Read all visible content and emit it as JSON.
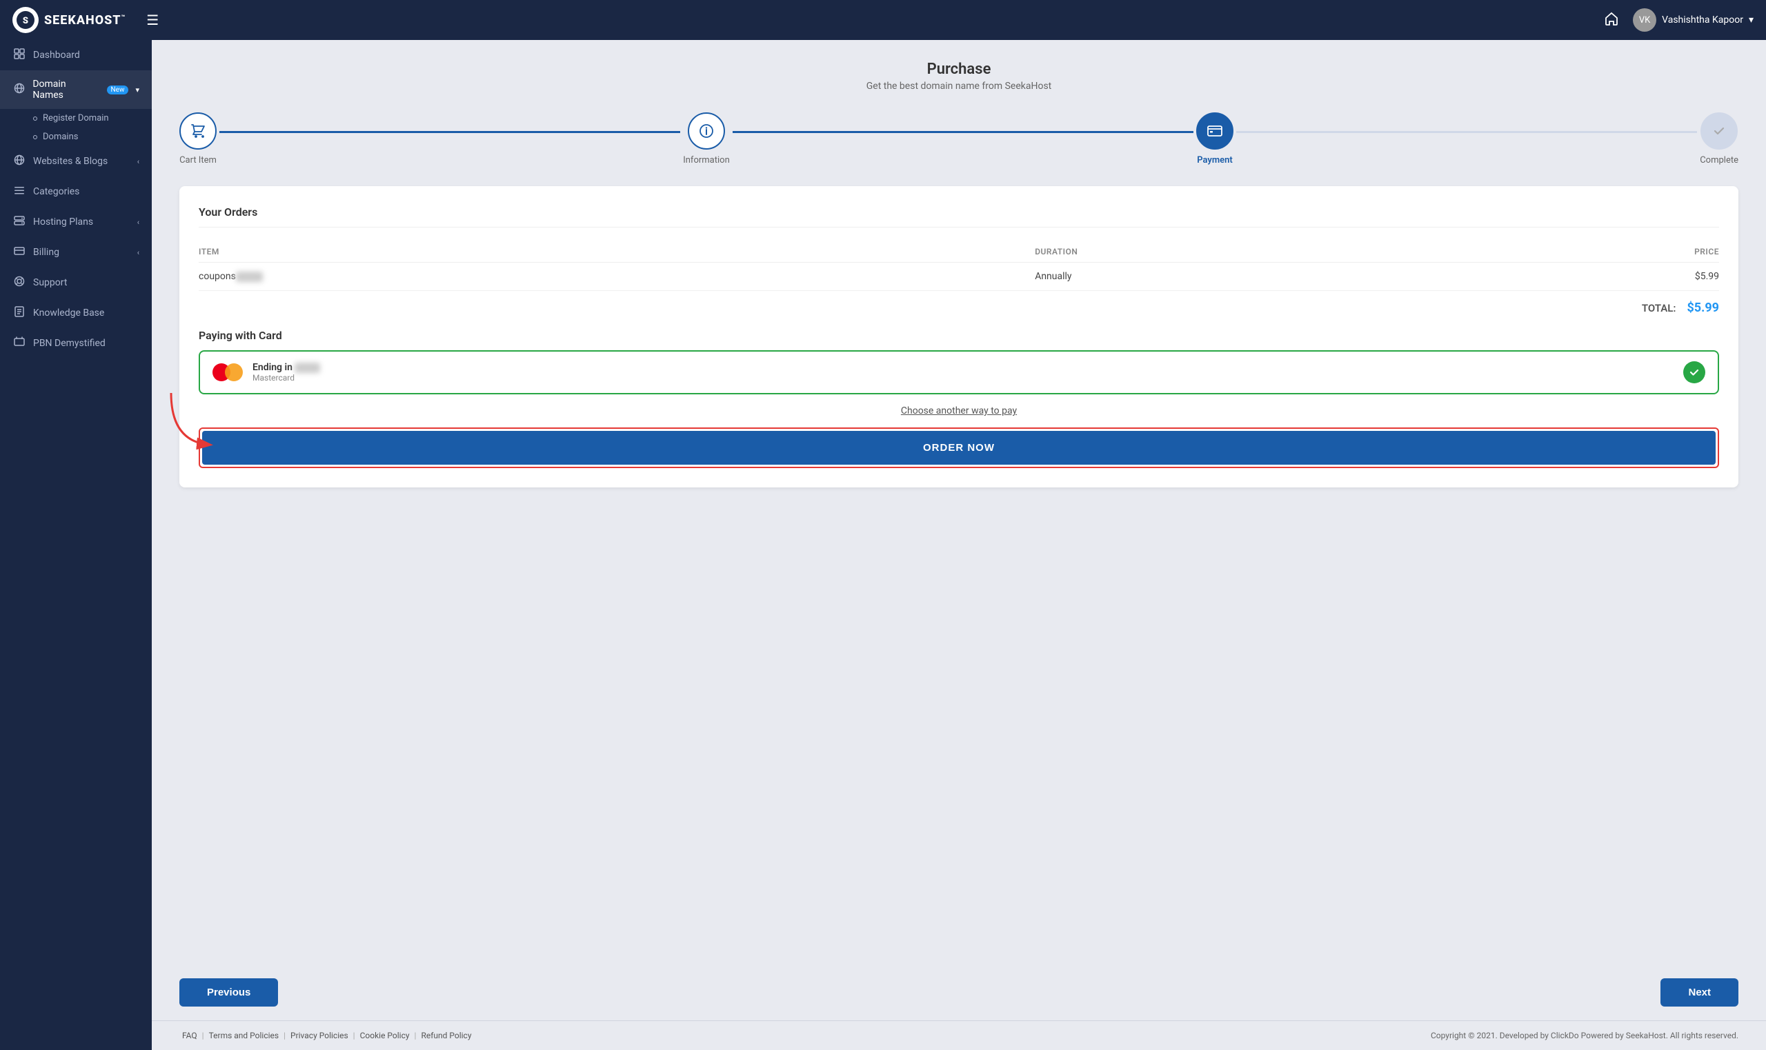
{
  "app": {
    "name": "SEEKAHOST",
    "name_tm": "™"
  },
  "topbar": {
    "menu_label": "☰",
    "home_label": "⌂",
    "user_name": "Vashishtha Kapoor",
    "user_chevron": "▾"
  },
  "sidebar": {
    "items": [
      {
        "id": "dashboard",
        "icon": "⌂",
        "label": "Dashboard"
      },
      {
        "id": "domain-names",
        "icon": "🌐",
        "label": "Domain Names",
        "badge": "New",
        "chevron": "▾",
        "active": true
      },
      {
        "id": "register-domain",
        "icon": "○",
        "label": "Register Domain",
        "sub": true
      },
      {
        "id": "domains",
        "icon": "○",
        "label": "Domains",
        "sub": true
      },
      {
        "id": "websites-blogs",
        "icon": "🌐",
        "label": "Websites & Blogs",
        "chevron": "‹"
      },
      {
        "id": "categories",
        "icon": "☰",
        "label": "Categories"
      },
      {
        "id": "hosting-plans",
        "icon": "📦",
        "label": "Hosting Plans",
        "chevron": "‹"
      },
      {
        "id": "billing",
        "icon": "💳",
        "label": "Billing",
        "chevron": "‹"
      },
      {
        "id": "support",
        "icon": "⚙",
        "label": "Support"
      },
      {
        "id": "knowledge-base",
        "icon": "📖",
        "label": "Knowledge Base"
      },
      {
        "id": "pbn-demystified",
        "icon": "🖥",
        "label": "PBN Demystified"
      }
    ]
  },
  "page": {
    "title": "Purchase",
    "subtitle": "Get the best domain name from SeekaHost"
  },
  "stepper": {
    "steps": [
      {
        "id": "cart",
        "icon": "🛒",
        "label": "Cart Item",
        "state": "done"
      },
      {
        "id": "info",
        "icon": "ℹ",
        "label": "Information",
        "state": "done"
      },
      {
        "id": "payment",
        "icon": "💳",
        "label": "Payment",
        "state": "active"
      },
      {
        "id": "complete",
        "icon": "✓",
        "label": "Complete",
        "state": "inactive"
      }
    ]
  },
  "orders": {
    "title": "Your Orders",
    "columns": {
      "item": "ITEM",
      "duration": "DURATION",
      "price": "PRICE"
    },
    "rows": [
      {
        "item": "coupons",
        "item_blurred": "••••••••",
        "duration": "Annually",
        "price": "$5.99"
      }
    ],
    "total_label": "TOTAL:",
    "total_value": "$5.99"
  },
  "payment": {
    "label": "Paying with Card",
    "card": {
      "ending_label": "Ending in",
      "ending_blurred": "••••",
      "type": "Mastercard"
    },
    "choose_link": "Choose another way to pay",
    "order_btn": "ORDER NOW"
  },
  "navigation": {
    "previous": "Previous",
    "next": "Next"
  },
  "footer": {
    "links": [
      "FAQ",
      "Terms and Policies",
      "Privacy Policies",
      "Cookie Policy",
      "Refund Policy"
    ],
    "copyright": "Copyright © 2021. Developed by ClickDo Powered by SeekaHost. All rights reserved."
  }
}
